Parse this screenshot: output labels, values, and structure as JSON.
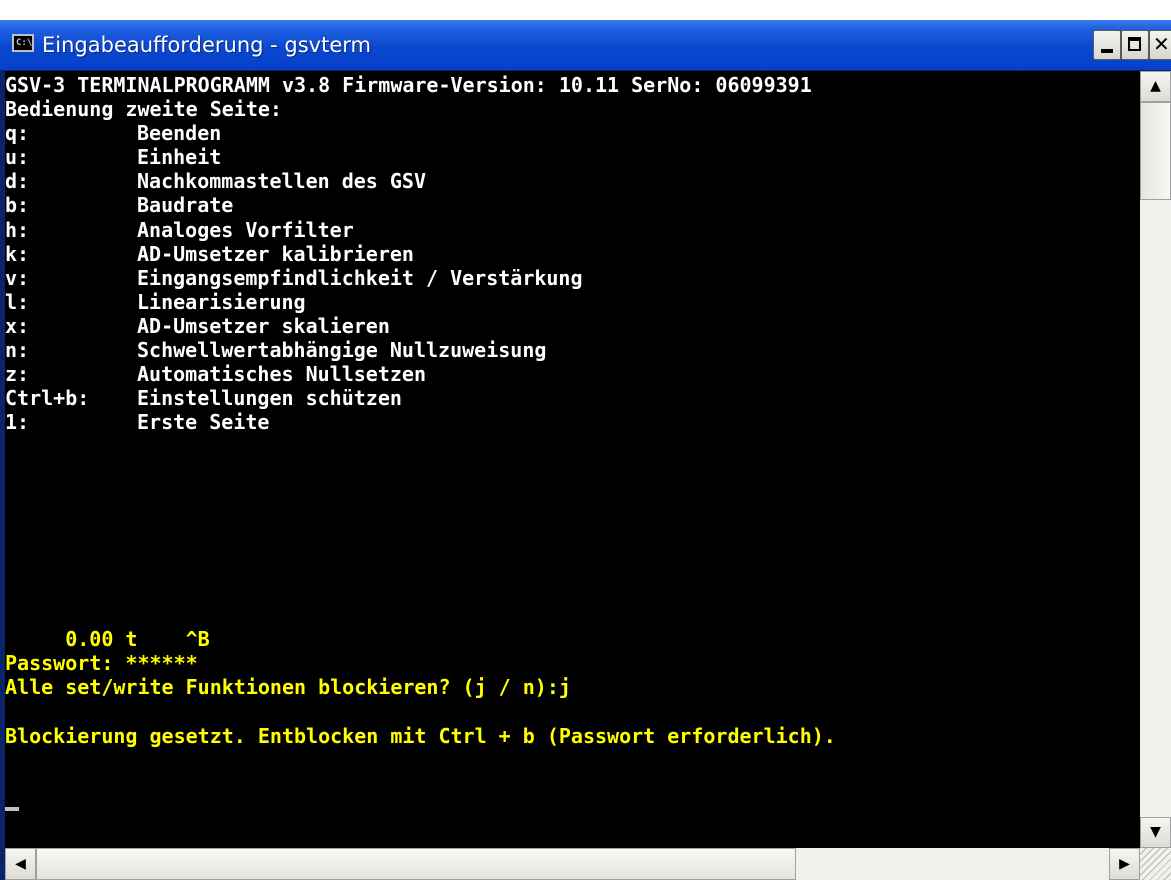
{
  "window": {
    "title": "Eingabeaufforderung - gsvterm",
    "icon": "cmd-icon",
    "icon_text": "C:\\"
  },
  "controls": {
    "minimize": "minimize-icon",
    "maximize": "maximize-icon",
    "close": "close-icon",
    "close_glyph": "✕"
  },
  "console": {
    "header_lines": [
      "GSV-3 TERMINALPROGRAMM v3.8 Firmware-Version: 10.11 SerNo: 06099391",
      "Bedienung zweite Seite:"
    ],
    "menu": [
      {
        "key": "q:",
        "label": "Beenden"
      },
      {
        "key": "u:",
        "label": "Einheit"
      },
      {
        "key": "d:",
        "label": "Nachkommastellen des GSV"
      },
      {
        "key": "b:",
        "label": "Baudrate"
      },
      {
        "key": "h:",
        "label": "Analoges Vorfilter"
      },
      {
        "key": "k:",
        "label": "AD-Umsetzer kalibrieren"
      },
      {
        "key": "v:",
        "label": "Eingangsempfindlichkeit / Verstärkung"
      },
      {
        "key": "l:",
        "label": "Linearisierung"
      },
      {
        "key": "x:",
        "label": "AD-Umsetzer skalieren"
      },
      {
        "key": "n:",
        "label": "Schwellwertabhängige Nullzuweisung"
      },
      {
        "key": "z:",
        "label": "Automatisches Nullsetzen"
      },
      {
        "key": "Ctrl+b:",
        "label": "Einstellungen schützen"
      },
      {
        "key": "1:",
        "label": "Erste Seite"
      }
    ],
    "status_line": "     0.00 t    ^B",
    "password_line": "Passwort: ******",
    "question_line": "Alle set/write Funktionen blockieren? (j / n):j",
    "result_line": "Blockierung gesetzt. Entblocken mit Ctrl + b (Passwort erforderlich)."
  },
  "scrollbars": {
    "up_glyph": "▲",
    "down_glyph": "▼",
    "left_glyph": "◀",
    "right_glyph": "▶"
  },
  "colors": {
    "console_bg": "#000000",
    "text_white": "#ffffff",
    "text_yellow": "#ffff00",
    "titlebar_blue": "#0a47d0"
  }
}
